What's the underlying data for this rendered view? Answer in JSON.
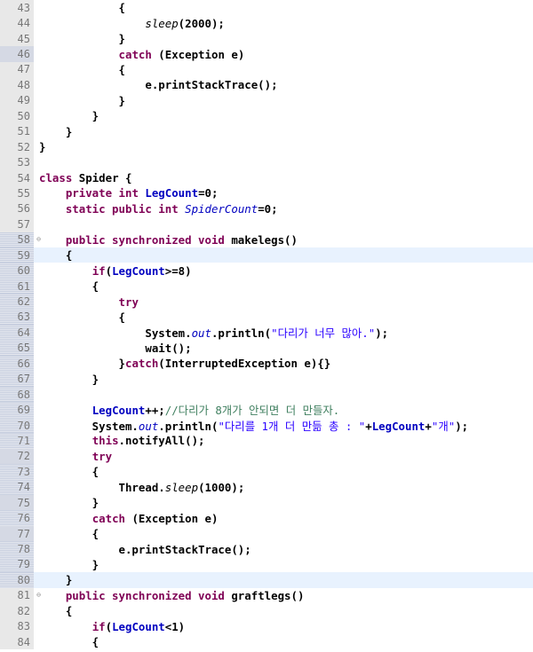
{
  "editor": {
    "lines": [
      {
        "n": "43",
        "hatched": false,
        "marked": false,
        "current": false,
        "fold": "",
        "tokens": [
          {
            "t": "pl",
            "v": "            {"
          }
        ]
      },
      {
        "n": "44",
        "hatched": false,
        "marked": false,
        "current": false,
        "fold": "",
        "tokens": [
          {
            "t": "pl",
            "v": "                "
          },
          {
            "t": "stm",
            "v": "sleep"
          },
          {
            "t": "pl",
            "v": "(2000);"
          }
        ]
      },
      {
        "n": "45",
        "hatched": false,
        "marked": false,
        "current": false,
        "fold": "",
        "tokens": [
          {
            "t": "pl",
            "v": "            }"
          }
        ]
      },
      {
        "n": "46",
        "hatched": false,
        "marked": true,
        "current": false,
        "fold": "",
        "tokens": [
          {
            "t": "pl",
            "v": "            "
          },
          {
            "t": "kw",
            "v": "catch"
          },
          {
            "t": "pl",
            "v": " (Exception e)"
          }
        ]
      },
      {
        "n": "47",
        "hatched": false,
        "marked": false,
        "current": false,
        "fold": "",
        "tokens": [
          {
            "t": "pl",
            "v": "            {"
          }
        ]
      },
      {
        "n": "48",
        "hatched": false,
        "marked": false,
        "current": false,
        "fold": "",
        "tokens": [
          {
            "t": "pl",
            "v": "                e.printStackTrace();"
          }
        ]
      },
      {
        "n": "49",
        "hatched": false,
        "marked": false,
        "current": false,
        "fold": "",
        "tokens": [
          {
            "t": "pl",
            "v": "            }"
          }
        ]
      },
      {
        "n": "50",
        "hatched": false,
        "marked": false,
        "current": false,
        "fold": "",
        "tokens": [
          {
            "t": "pl",
            "v": "        }"
          }
        ]
      },
      {
        "n": "51",
        "hatched": false,
        "marked": false,
        "current": false,
        "fold": "",
        "tokens": [
          {
            "t": "pl",
            "v": "    }"
          }
        ]
      },
      {
        "n": "52",
        "hatched": false,
        "marked": false,
        "current": false,
        "fold": "",
        "tokens": [
          {
            "t": "pl",
            "v": "}"
          }
        ]
      },
      {
        "n": "53",
        "hatched": false,
        "marked": false,
        "current": false,
        "fold": "",
        "tokens": [
          {
            "t": "pl",
            "v": ""
          }
        ]
      },
      {
        "n": "54",
        "hatched": false,
        "marked": false,
        "current": false,
        "fold": "",
        "tokens": [
          {
            "t": "kw",
            "v": "class"
          },
          {
            "t": "pl",
            "v": " Spider {"
          }
        ]
      },
      {
        "n": "55",
        "hatched": false,
        "marked": false,
        "current": false,
        "fold": "",
        "tokens": [
          {
            "t": "pl",
            "v": "    "
          },
          {
            "t": "kw",
            "v": "private int"
          },
          {
            "t": "pl",
            "v": " "
          },
          {
            "t": "fld",
            "v": "LegCount"
          },
          {
            "t": "pl",
            "v": "=0;"
          }
        ]
      },
      {
        "n": "56",
        "hatched": false,
        "marked": false,
        "current": false,
        "fold": "",
        "tokens": [
          {
            "t": "pl",
            "v": "    "
          },
          {
            "t": "kw",
            "v": "static public int"
          },
          {
            "t": "pl",
            "v": " "
          },
          {
            "t": "st",
            "v": "SpiderCount"
          },
          {
            "t": "pl",
            "v": "=0;"
          }
        ]
      },
      {
        "n": "57",
        "hatched": false,
        "marked": false,
        "current": false,
        "fold": "",
        "tokens": [
          {
            "t": "pl",
            "v": ""
          }
        ]
      },
      {
        "n": "58",
        "hatched": true,
        "marked": false,
        "current": false,
        "fold": "⊖",
        "tokens": [
          {
            "t": "pl",
            "v": "    "
          },
          {
            "t": "kw",
            "v": "public synchronized void"
          },
          {
            "t": "pl",
            "v": " makelegs()"
          }
        ]
      },
      {
        "n": "59",
        "hatched": true,
        "marked": false,
        "current": true,
        "fold": "",
        "tokens": [
          {
            "t": "pl",
            "v": "    {"
          }
        ]
      },
      {
        "n": "60",
        "hatched": true,
        "marked": false,
        "current": false,
        "fold": "",
        "tokens": [
          {
            "t": "pl",
            "v": "        "
          },
          {
            "t": "kw",
            "v": "if"
          },
          {
            "t": "pl",
            "v": "("
          },
          {
            "t": "fld",
            "v": "LegCount"
          },
          {
            "t": "pl",
            "v": ">=8)"
          }
        ]
      },
      {
        "n": "61",
        "hatched": true,
        "marked": false,
        "current": false,
        "fold": "",
        "tokens": [
          {
            "t": "pl",
            "v": "        {"
          }
        ]
      },
      {
        "n": "62",
        "hatched": true,
        "marked": false,
        "current": false,
        "fold": "",
        "tokens": [
          {
            "t": "pl",
            "v": "            "
          },
          {
            "t": "kw",
            "v": "try"
          }
        ]
      },
      {
        "n": "63",
        "hatched": true,
        "marked": false,
        "current": false,
        "fold": "",
        "tokens": [
          {
            "t": "pl",
            "v": "            {"
          }
        ]
      },
      {
        "n": "64",
        "hatched": true,
        "marked": false,
        "current": false,
        "fold": "",
        "tokens": [
          {
            "t": "pl",
            "v": "                System."
          },
          {
            "t": "st",
            "v": "out"
          },
          {
            "t": "pl",
            "v": ".println("
          },
          {
            "t": "str",
            "v": "\"다리가 너무 많아.\""
          },
          {
            "t": "pl",
            "v": ");"
          }
        ]
      },
      {
        "n": "65",
        "hatched": true,
        "marked": false,
        "current": false,
        "fold": "",
        "tokens": [
          {
            "t": "pl",
            "v": "                wait();"
          }
        ]
      },
      {
        "n": "66",
        "hatched": true,
        "marked": false,
        "current": false,
        "fold": "",
        "tokens": [
          {
            "t": "pl",
            "v": "            }"
          },
          {
            "t": "kw",
            "v": "catch"
          },
          {
            "t": "pl",
            "v": "(InterruptedException e){}"
          }
        ]
      },
      {
        "n": "67",
        "hatched": true,
        "marked": false,
        "current": false,
        "fold": "",
        "tokens": [
          {
            "t": "pl",
            "v": "        }"
          }
        ]
      },
      {
        "n": "68",
        "hatched": true,
        "marked": false,
        "current": false,
        "fold": "",
        "tokens": [
          {
            "t": "pl",
            "v": ""
          }
        ]
      },
      {
        "n": "69",
        "hatched": true,
        "marked": false,
        "current": false,
        "fold": "",
        "tokens": [
          {
            "t": "pl",
            "v": "        "
          },
          {
            "t": "fld",
            "v": "LegCount"
          },
          {
            "t": "pl",
            "v": "++;"
          },
          {
            "t": "cmt",
            "v": "//다리가 8개가 안되면 더 만들자."
          }
        ]
      },
      {
        "n": "70",
        "hatched": true,
        "marked": false,
        "current": false,
        "fold": "",
        "tokens": [
          {
            "t": "pl",
            "v": "        System."
          },
          {
            "t": "st",
            "v": "out"
          },
          {
            "t": "pl",
            "v": ".println("
          },
          {
            "t": "str",
            "v": "\"다리를 1개 더 만듦 총 : \""
          },
          {
            "t": "pl",
            "v": "+"
          },
          {
            "t": "fld",
            "v": "LegCount"
          },
          {
            "t": "pl",
            "v": "+"
          },
          {
            "t": "str",
            "v": "\"개\""
          },
          {
            "t": "pl",
            "v": ");"
          }
        ]
      },
      {
        "n": "71",
        "hatched": true,
        "marked": false,
        "current": false,
        "fold": "",
        "tokens": [
          {
            "t": "pl",
            "v": "        "
          },
          {
            "t": "kw",
            "v": "this"
          },
          {
            "t": "pl",
            "v": ".notifyAll();"
          }
        ]
      },
      {
        "n": "72",
        "hatched": true,
        "marked": true,
        "current": false,
        "fold": "",
        "tokens": [
          {
            "t": "pl",
            "v": "        "
          },
          {
            "t": "kw",
            "v": "try"
          }
        ]
      },
      {
        "n": "73",
        "hatched": true,
        "marked": false,
        "current": false,
        "fold": "",
        "tokens": [
          {
            "t": "pl",
            "v": "        {"
          }
        ]
      },
      {
        "n": "74",
        "hatched": true,
        "marked": false,
        "current": false,
        "fold": "",
        "tokens": [
          {
            "t": "pl",
            "v": "            Thread."
          },
          {
            "t": "stm",
            "v": "sleep"
          },
          {
            "t": "pl",
            "v": "(1000);"
          }
        ]
      },
      {
        "n": "75",
        "hatched": true,
        "marked": true,
        "current": false,
        "fold": "",
        "tokens": [
          {
            "t": "pl",
            "v": "        }"
          }
        ]
      },
      {
        "n": "76",
        "hatched": true,
        "marked": false,
        "current": false,
        "fold": "",
        "tokens": [
          {
            "t": "pl",
            "v": "        "
          },
          {
            "t": "kw",
            "v": "catch"
          },
          {
            "t": "pl",
            "v": " (Exception e)"
          }
        ]
      },
      {
        "n": "77",
        "hatched": true,
        "marked": true,
        "current": false,
        "fold": "",
        "tokens": [
          {
            "t": "pl",
            "v": "        {"
          }
        ]
      },
      {
        "n": "78",
        "hatched": true,
        "marked": false,
        "current": false,
        "fold": "",
        "tokens": [
          {
            "t": "pl",
            "v": "            e.printStackTrace();"
          }
        ]
      },
      {
        "n": "79",
        "hatched": true,
        "marked": false,
        "current": false,
        "fold": "",
        "tokens": [
          {
            "t": "pl",
            "v": "        }"
          }
        ]
      },
      {
        "n": "80",
        "hatched": true,
        "marked": false,
        "current": true,
        "fold": "",
        "tokens": [
          {
            "t": "pl",
            "v": "    }"
          }
        ]
      },
      {
        "n": "81",
        "hatched": false,
        "marked": false,
        "current": false,
        "fold": "⊖",
        "tokens": [
          {
            "t": "pl",
            "v": "    "
          },
          {
            "t": "kw",
            "v": "public synchronized void"
          },
          {
            "t": "pl",
            "v": " graftlegs()"
          }
        ]
      },
      {
        "n": "82",
        "hatched": false,
        "marked": false,
        "current": false,
        "fold": "",
        "tokens": [
          {
            "t": "pl",
            "v": "    {"
          }
        ]
      },
      {
        "n": "83",
        "hatched": false,
        "marked": false,
        "current": false,
        "fold": "",
        "tokens": [
          {
            "t": "pl",
            "v": "        "
          },
          {
            "t": "kw",
            "v": "if"
          },
          {
            "t": "pl",
            "v": "("
          },
          {
            "t": "fld",
            "v": "LegCount"
          },
          {
            "t": "pl",
            "v": "<1)"
          }
        ]
      },
      {
        "n": "84",
        "hatched": false,
        "marked": false,
        "current": false,
        "fold": "",
        "tokens": [
          {
            "t": "pl",
            "v": "        {"
          }
        ]
      }
    ]
  }
}
